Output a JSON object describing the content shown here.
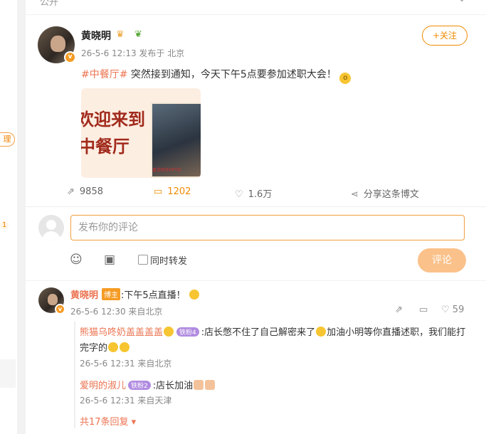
{
  "sidebar": {
    "tag_label": "理",
    "badge": "1"
  },
  "visibility": "公开",
  "post": {
    "author": "黄晓明",
    "time_source": "26-5-6 12:13 发布于 北京",
    "follow_label": "+关注",
    "hashtag": "#中餐厅#",
    "text": " 突然接到通知，今天下午5点要参加述职大会！",
    "image": {
      "line1": "欢迎来到",
      "line2": "中餐厅",
      "caption": "盘货制作PPT中"
    }
  },
  "actions": {
    "repost": "9858",
    "comments": "1202",
    "likes": "1.6万",
    "share": "分享这条博文"
  },
  "composer": {
    "placeholder": "发布你的评论",
    "repost_label": "同时转发",
    "submit_label": "评论"
  },
  "comment": {
    "author": "黄晓明",
    "badge": "博主",
    "text": ":下午5点直播！",
    "meta": "26-5-6 12:30 来自北京",
    "likes": "59",
    "replies": [
      {
        "name": "熊猫乌咚奶盖盖盖盖",
        "level": "铁粉4",
        "text": ":店长憋不住了自己解密来了",
        "text2": "加油小明等你直播述职，我们能打",
        "text3": "完字的",
        "meta": "26-5-6 12:31 来自北京"
      },
      {
        "name": "爱明的淑儿",
        "level": "铁粉2",
        "text": ":店长加油",
        "meta": "26-5-6 12:31 来自天津"
      }
    ],
    "more": "共17条回复"
  }
}
